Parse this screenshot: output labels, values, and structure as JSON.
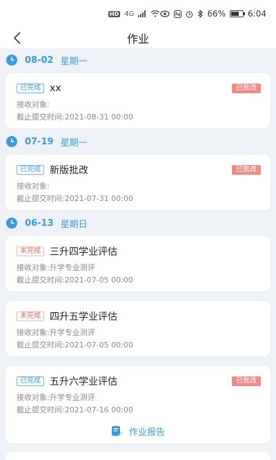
{
  "status_bar": {
    "network": "HD",
    "signal": "4G",
    "battery_percent": "66%",
    "battery_level": 0.66,
    "time": "6:04"
  },
  "nav": {
    "back_icon": "chevron-left-icon",
    "title": "作业"
  },
  "groups": [
    {
      "date": "08-02",
      "weekday": "星期一",
      "items": [
        {
          "status": "已完成",
          "title": "xx",
          "graded": "已批改",
          "recipient_label": "接收对象:",
          "recipient": "",
          "deadline_label": "截止提交时间:",
          "deadline": "2021-08-31 00:00"
        }
      ]
    },
    {
      "date": "07-19",
      "weekday": "星期一",
      "items": [
        {
          "status": "已完成",
          "title": "新版批改",
          "graded": "已批改",
          "recipient_label": "接收对象:",
          "recipient": "",
          "deadline_label": "截止提交时间:",
          "deadline": "2021-07-31 00:00"
        }
      ]
    },
    {
      "date": "06-13",
      "weekday": "星期日",
      "items": [
        {
          "status": "未完成",
          "title": "三升四学业评估",
          "graded": "",
          "recipient_label": "接收对象:",
          "recipient": "升学专业测评",
          "deadline_label": "截止提交时间:",
          "deadline": "2021-07-05 00:00"
        },
        {
          "status": "未完成",
          "title": "四升五学业评估",
          "graded": "",
          "recipient_label": "接收对象:",
          "recipient": "升学专业测评",
          "deadline_label": "截止提交时间:",
          "deadline": "2021-07-05 00:00"
        },
        {
          "status": "已完成",
          "title": "五升六学业评估",
          "graded": "已批改",
          "recipient_label": "接收对象:",
          "recipient": "升学专业测评",
          "deadline_label": "截止提交时间:",
          "deadline": "2021-07-16 00:00",
          "action": "作业报告"
        }
      ]
    }
  ],
  "colors": {
    "accent": "#3b9ad9",
    "graded_badge": "#f08b84",
    "pending_tag": "#e06a53",
    "background": "#eef1f6"
  }
}
